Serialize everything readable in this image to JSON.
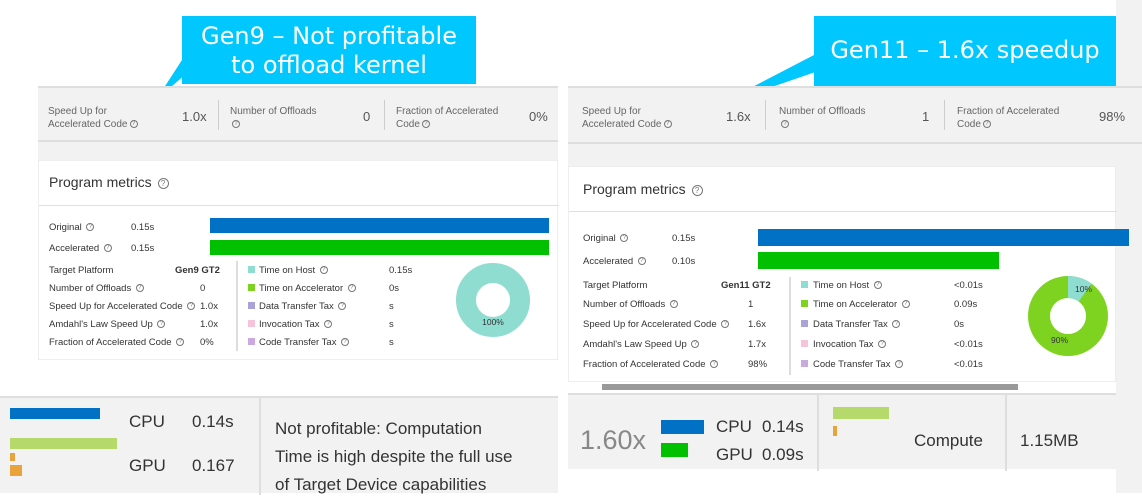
{
  "colors": {
    "callout": "#00c7fd",
    "original_bar": "#0071c5",
    "accelerated_bar": "#00c000",
    "host": "#8fdcd0",
    "accelerator": "#7ed321",
    "transfer": "#a9a3d8",
    "invocation": "#f7c3d8",
    "code_transfer": "#c9a9e0",
    "bottom_green": "#b5d96b",
    "bottom_orange": "#e8a33b"
  },
  "left": {
    "callout": {
      "line1": "Gen9 – Not profitable",
      "line2": "to offload kernel"
    },
    "summary": {
      "speedup_label1": "Speed Up for",
      "speedup_label2": "Accelerated Code",
      "speedup_value": "1.0x",
      "offloads_label": "Number of Offloads",
      "offloads_value": "0",
      "fraction_label1": "Fraction of Accelerated",
      "fraction_label2": "Code",
      "fraction_value": "0%"
    },
    "metrics": {
      "title": "Program metrics",
      "original_label": "Original",
      "original_value": "0.15s",
      "accelerated_label": "Accelerated",
      "accelerated_value": "0.15s",
      "rows": [
        {
          "label": "Target Platform",
          "value": "Gen9 GT2"
        },
        {
          "label": "Number of Offloads",
          "value": "0"
        },
        {
          "label": "Speed Up for Accelerated Code",
          "value": "1.0x"
        },
        {
          "label": "Amdahl's Law Speed Up",
          "value": "1.0x"
        },
        {
          "label": "Fraction of Accelerated Code",
          "value": "0%"
        }
      ],
      "legend": [
        {
          "label": "Time on Host",
          "value": "0.15s"
        },
        {
          "label": "Time on Accelerator",
          "value": "0s"
        },
        {
          "label": "Data Transfer Tax",
          "value": "s"
        },
        {
          "label": "Invocation Tax",
          "value": "s"
        },
        {
          "label": "Code Transfer Tax",
          "value": "s"
        }
      ],
      "pie_label": "100%",
      "pie": {
        "host": 1.0,
        "accelerator": 0.0
      }
    },
    "bottom": {
      "cpu_label": "CPU",
      "cpu_value": "0.14s",
      "gpu_label": "GPU",
      "gpu_value": "0.167",
      "message": [
        "Not profitable: Computation",
        "Time is high despite the full use",
        "of Target Device capabilities"
      ]
    }
  },
  "right": {
    "callout": {
      "line1": "Gen11 – 1.6x speedup"
    },
    "summary": {
      "speedup_label1": "Speed Up for",
      "speedup_label2": "Accelerated Code",
      "speedup_value": "1.6x",
      "offloads_label": "Number of Offloads",
      "offloads_value": "1",
      "fraction_label1": "Fraction of Accelerated",
      "fraction_label2": "Code",
      "fraction_value": "98%"
    },
    "metrics": {
      "title": "Program metrics",
      "original_label": "Original",
      "original_value": "0.15s",
      "accelerated_label": "Accelerated",
      "accelerated_value": "0.10s",
      "rows": [
        {
          "label": "Target Platform",
          "value": "Gen11 GT2"
        },
        {
          "label": "Number of Offloads",
          "value": "1"
        },
        {
          "label": "Speed Up for Accelerated Code",
          "value": "1.6x"
        },
        {
          "label": "Amdahl's Law Speed Up",
          "value": "1.7x"
        },
        {
          "label": "Fraction of Accelerated Code",
          "value": "98%"
        }
      ],
      "legend": [
        {
          "label": "Time on Host",
          "value": "<0.01s"
        },
        {
          "label": "Time on Accelerator",
          "value": "0.09s"
        },
        {
          "label": "Data Transfer Tax",
          "value": "0s"
        },
        {
          "label": "Invocation Tax",
          "value": "<0.01s"
        },
        {
          "label": "Code Transfer Tax",
          "value": "<0.01s"
        }
      ],
      "pie_label_host": "10%",
      "pie_label_acc": "90%",
      "pie": {
        "host": 0.1,
        "accelerator": 0.9
      }
    },
    "bottom": {
      "speedup": "1.60x",
      "cpu_label": "CPU",
      "cpu_value": "0.14s",
      "gpu_label": "GPU",
      "gpu_value": "0.09s",
      "compute_label": "Compute",
      "size": "1.15MB"
    }
  }
}
